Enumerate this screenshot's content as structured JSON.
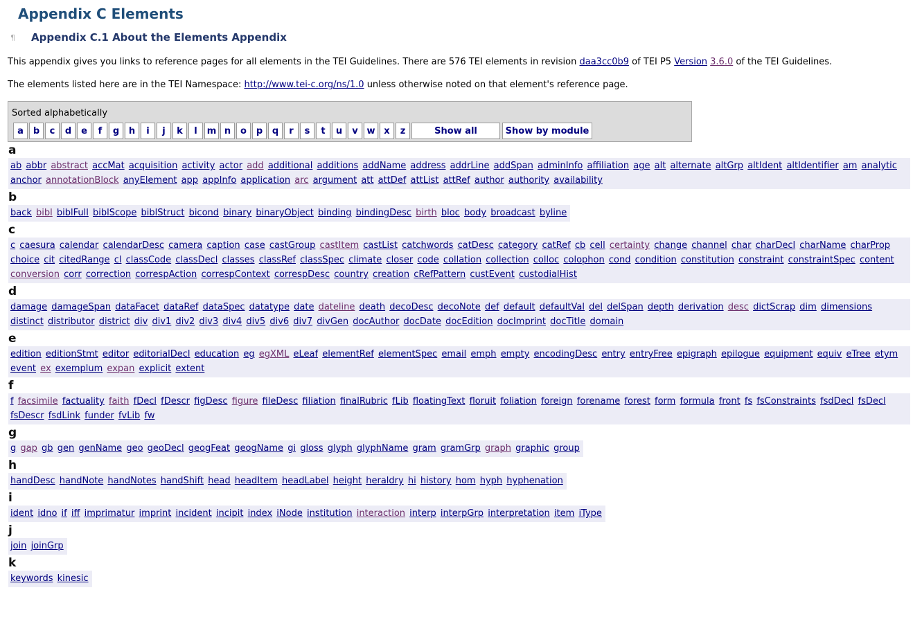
{
  "title": "Appendix C Elements",
  "subtitle": "Appendix C.1 About the Elements Appendix",
  "pilcrow": "¶",
  "intro": {
    "p1_before": "This appendix gives you links to reference pages for all elements in the TEI Guidelines. There are 576 TEI elements in revision ",
    "revision_link": "daa3cc0b9",
    "p1_mid": " of TEI P5 ",
    "version_link": "Version",
    "version_num_link": "3.6.0",
    "p1_after": " of the TEI Guidelines.",
    "p2_before": "The elements listed here are in the TEI Namespace: ",
    "namespace_link": "http://www.tei-c.org/ns/1.0",
    "p2_after": " unless otherwise noted on that element's reference page."
  },
  "sort": {
    "label": "Sorted alphabetically",
    "letters": [
      "a",
      "b",
      "c",
      "d",
      "e",
      "f",
      "g",
      "h",
      "i",
      "j",
      "k",
      "l",
      "m",
      "n",
      "o",
      "p",
      "q",
      "r",
      "s",
      "t",
      "u",
      "v",
      "w",
      "x",
      "z"
    ],
    "show_all": "Show all",
    "show_by_module": "Show by module"
  },
  "groups": [
    {
      "letter": "a",
      "full": true,
      "items": [
        "ab",
        "abbr",
        "abstract",
        "accMat",
        "acquisition",
        "activity",
        "actor",
        "add",
        "additional",
        "additions",
        "addName",
        "address",
        "addrLine",
        "addSpan",
        "adminInfo",
        "affiliation",
        "age",
        "alt",
        "alternate",
        "altGrp",
        "altIdent",
        "altIdentifier",
        "am",
        "analytic",
        "anchor",
        "annotationBlock",
        "anyElement",
        "app",
        "appInfo",
        "application",
        "arc",
        "argument",
        "att",
        "attDef",
        "attList",
        "attRef",
        "author",
        "authority",
        "availability"
      ],
      "visited": [
        "abstract",
        "add",
        "annotationBlock",
        "arc"
      ]
    },
    {
      "letter": "b",
      "full": false,
      "items": [
        "back",
        "bibl",
        "biblFull",
        "biblScope",
        "biblStruct",
        "bicond",
        "binary",
        "binaryObject",
        "binding",
        "bindingDesc",
        "birth",
        "bloc",
        "body",
        "broadcast",
        "byline"
      ],
      "visited": [
        "bibl",
        "birth"
      ]
    },
    {
      "letter": "c",
      "full": true,
      "items": [
        "c",
        "caesura",
        "calendar",
        "calendarDesc",
        "camera",
        "caption",
        "case",
        "castGroup",
        "castItem",
        "castList",
        "catchwords",
        "catDesc",
        "category",
        "catRef",
        "cb",
        "cell",
        "certainty",
        "change",
        "channel",
        "char",
        "charDecl",
        "charName",
        "charProp",
        "choice",
        "cit",
        "citedRange",
        "cl",
        "classCode",
        "classDecl",
        "classes",
        "classRef",
        "classSpec",
        "climate",
        "closer",
        "code",
        "collation",
        "collection",
        "colloc",
        "colophon",
        "cond",
        "condition",
        "constitution",
        "constraint",
        "constraintSpec",
        "content",
        "conversion",
        "corr",
        "correction",
        "correspAction",
        "correspContext",
        "correspDesc",
        "country",
        "creation",
        "cRefPattern",
        "custEvent",
        "custodialHist"
      ],
      "visited": [
        "castItem",
        "certainty",
        "conversion"
      ]
    },
    {
      "letter": "d",
      "full": true,
      "items": [
        "damage",
        "damageSpan",
        "dataFacet",
        "dataRef",
        "dataSpec",
        "datatype",
        "date",
        "dateline",
        "death",
        "decoDesc",
        "decoNote",
        "def",
        "default",
        "defaultVal",
        "del",
        "delSpan",
        "depth",
        "derivation",
        "desc",
        "dictScrap",
        "dim",
        "dimensions",
        "distinct",
        "distributor",
        "district",
        "div",
        "div1",
        "div2",
        "div3",
        "div4",
        "div5",
        "div6",
        "div7",
        "divGen",
        "docAuthor",
        "docDate",
        "docEdition",
        "docImprint",
        "docTitle",
        "domain"
      ],
      "visited": [
        "dateline",
        "desc"
      ]
    },
    {
      "letter": "e",
      "full": true,
      "items": [
        "edition",
        "editionStmt",
        "editor",
        "editorialDecl",
        "education",
        "eg",
        "egXML",
        "eLeaf",
        "elementRef",
        "elementSpec",
        "email",
        "emph",
        "empty",
        "encodingDesc",
        "entry",
        "entryFree",
        "epigraph",
        "epilogue",
        "equipment",
        "equiv",
        "eTree",
        "etym",
        "event",
        "ex",
        "exemplum",
        "expan",
        "explicit",
        "extent"
      ],
      "visited": [
        "egXML",
        "ex",
        "expan"
      ]
    },
    {
      "letter": "f",
      "full": true,
      "items": [
        "f",
        "facsimile",
        "factuality",
        "faith",
        "fDecl",
        "fDescr",
        "figDesc",
        "figure",
        "fileDesc",
        "filiation",
        "finalRubric",
        "fLib",
        "floatingText",
        "floruit",
        "foliation",
        "foreign",
        "forename",
        "forest",
        "form",
        "formula",
        "front",
        "fs",
        "fsConstraints",
        "fsdDecl",
        "fsDecl",
        "fsDescr",
        "fsdLink",
        "funder",
        "fvLib",
        "fw"
      ],
      "visited": [
        "facsimile",
        "faith",
        "figure"
      ]
    },
    {
      "letter": "g",
      "full": false,
      "items": [
        "g",
        "gap",
        "gb",
        "gen",
        "genName",
        "geo",
        "geoDecl",
        "geogFeat",
        "geogName",
        "gi",
        "gloss",
        "glyph",
        "glyphName",
        "gram",
        "gramGrp",
        "graph",
        "graphic",
        "group"
      ],
      "visited": [
        "gap",
        "graph"
      ]
    },
    {
      "letter": "h",
      "full": false,
      "items": [
        "handDesc",
        "handNote",
        "handNotes",
        "handShift",
        "head",
        "headItem",
        "headLabel",
        "height",
        "heraldry",
        "hi",
        "history",
        "hom",
        "hyph",
        "hyphenation"
      ],
      "visited": []
    },
    {
      "letter": "i",
      "full": false,
      "items": [
        "ident",
        "idno",
        "if",
        "iff",
        "imprimatur",
        "imprint",
        "incident",
        "incipit",
        "index",
        "iNode",
        "institution",
        "interaction",
        "interp",
        "interpGrp",
        "interpretation",
        "item",
        "iType"
      ],
      "visited": [
        "interaction"
      ]
    },
    {
      "letter": "j",
      "full": false,
      "items": [
        "join",
        "joinGrp"
      ],
      "visited": []
    },
    {
      "letter": "k",
      "full": false,
      "items": [
        "keywords",
        "kinesic"
      ],
      "visited": []
    }
  ]
}
